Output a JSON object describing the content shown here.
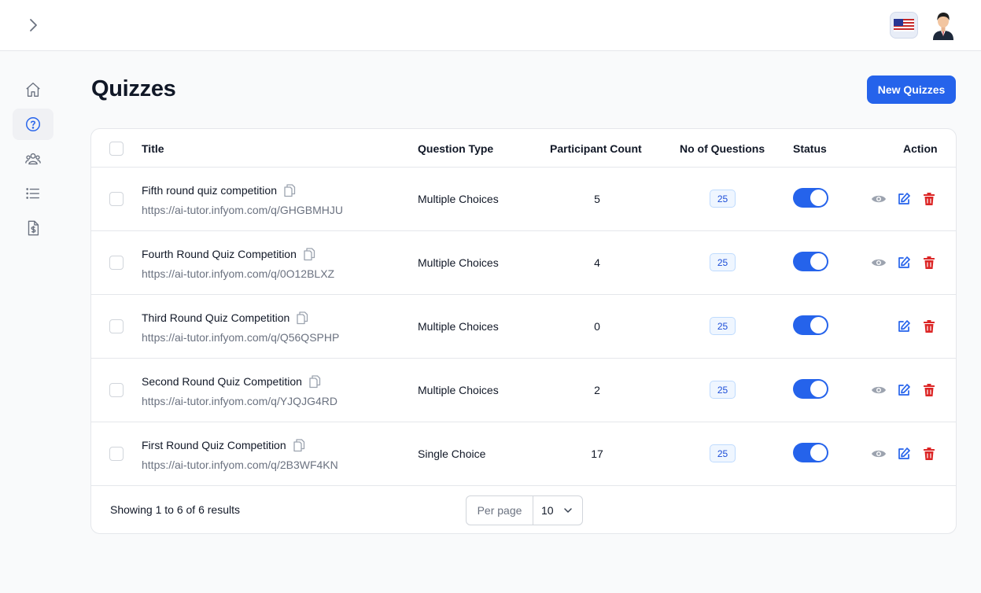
{
  "page": {
    "title": "Quizzes"
  },
  "header": {
    "new_button_label": "New Quizzes"
  },
  "table": {
    "columns": [
      "Title",
      "Question Type",
      "Participant Count",
      "No of Questions",
      "Status",
      "Action"
    ],
    "rows": [
      {
        "title": "Fifth round quiz competition",
        "url": "https://ai-tutor.infyom.com/q/GHGBMHJU",
        "question_type": "Multiple Choices",
        "participant_count": "5",
        "questions": "25",
        "status_on": true,
        "has_view": true
      },
      {
        "title": "Fourth Round Quiz Competition",
        "url": "https://ai-tutor.infyom.com/q/0O12BLXZ",
        "question_type": "Multiple Choices",
        "participant_count": "4",
        "questions": "25",
        "status_on": true,
        "has_view": true
      },
      {
        "title": "Third Round Quiz Competition",
        "url": "https://ai-tutor.infyom.com/q/Q56QSPHP",
        "question_type": "Multiple Choices",
        "participant_count": "0",
        "questions": "25",
        "status_on": true,
        "has_view": false
      },
      {
        "title": "Second Round Quiz Competition",
        "url": "https://ai-tutor.infyom.com/q/YJQJG4RD",
        "question_type": "Multiple Choices",
        "participant_count": "2",
        "questions": "25",
        "status_on": true,
        "has_view": true
      },
      {
        "title": "First Round Quiz Competition",
        "url": "https://ai-tutor.infyom.com/q/2B3WF4KN",
        "question_type": "Single Choice",
        "participant_count": "17",
        "questions": "25",
        "status_on": true,
        "has_view": true
      }
    ]
  },
  "footer": {
    "summary": "Showing 1 to 6 of 6 results",
    "per_page_label": "Per page",
    "per_page_value": "10"
  },
  "sidebar": {
    "items": [
      "home-icon",
      "question-icon",
      "users-icon",
      "list-icon",
      "billing-icon"
    ],
    "active_index": 1
  },
  "colors": {
    "primary": "#2563eb",
    "danger": "#dc2626",
    "muted": "#9ca3af"
  }
}
